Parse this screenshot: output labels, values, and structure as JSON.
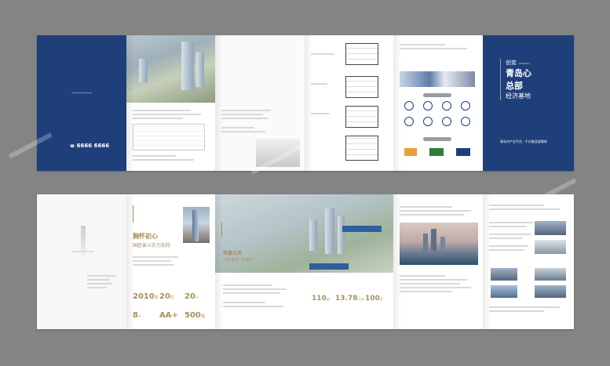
{
  "top_brochure": {
    "cover_front": {
      "phone": "6666 6666"
    },
    "cover_back": {
      "title_line1": "创变",
      "title_line1_en": "QINGDAO",
      "title_line2": "青岛心",
      "title_line3": "总部",
      "title_line4": "经济基地",
      "footer": "青岛市产业平台 · 千亿级总部载体",
      "colors": {
        "navy": "#1f3f7a"
      }
    }
  },
  "bottom_brochure": {
    "panel1_note": "",
    "panel2": {
      "heading": "胸怀初心",
      "subheading": "国匠奋斗实力加持",
      "stats": [
        {
          "value": "2010",
          "unit": "年"
        },
        {
          "value": "20",
          "unit": "亿"
        },
        {
          "value": "20",
          "unit": "+"
        },
        {
          "value": "8",
          "unit": "+"
        },
        {
          "value": "AA+",
          "unit": ""
        },
        {
          "value": "500",
          "unit": "强"
        }
      ]
    },
    "panel3": {
      "heading": "筑巢引凤",
      "subheading": "创变青岛“总名片”",
      "stats": [
        {
          "value": "110",
          "unit": "亩"
        },
        {
          "value": "13.78",
          "unit": "万㎡"
        },
        {
          "value": "100",
          "unit": "米"
        }
      ]
    }
  },
  "colors": {
    "background": "#848484",
    "gold": "#a98f5c"
  }
}
